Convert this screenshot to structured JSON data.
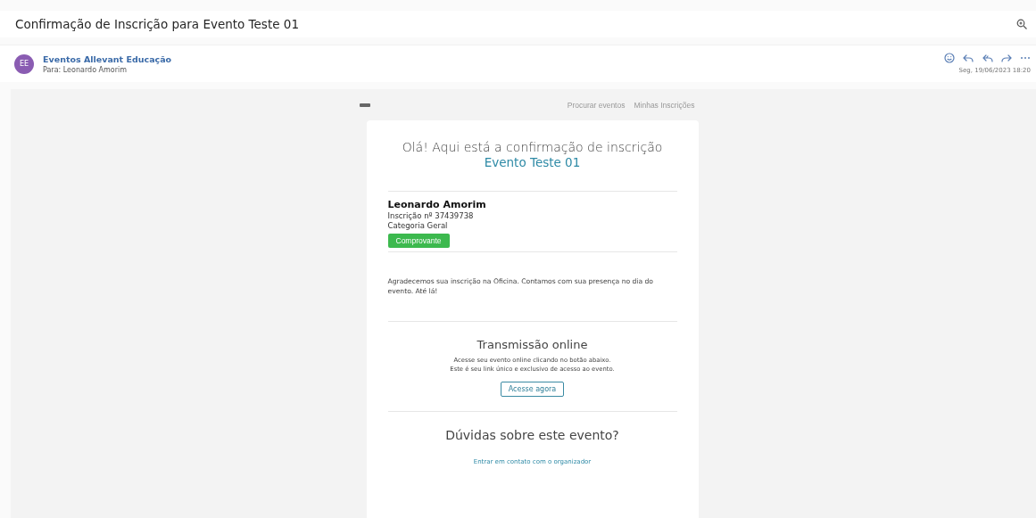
{
  "subject": "Confirmação de Inscrição para Evento Teste 01",
  "sender": {
    "initials": "EE",
    "name": "Eventos Allevant Educação",
    "to": "Para: Leonardo Amorim",
    "date": "Seg, 19/06/2023 18:20"
  },
  "email": {
    "nav": [
      "Procurar eventos",
      "Minhas Inscrições"
    ],
    "greeting": "Olá! Aqui está a confirmação de inscrição",
    "event": "Evento Teste 01",
    "attendee": {
      "name": "Leonardo Amorim",
      "registration": "Inscrição nº 37439738",
      "category": "Categoria Geral",
      "button": "Comprovante"
    },
    "message": "Agradecemos sua inscrição na Oficina. Contamos com sua presença no dia do evento. Até lá!",
    "stream": {
      "title": "Transmissão online",
      "lines": [
        "Acesse seu evento online clicando no botão abaixo.",
        "Este é seu link único e exclusivo de acesso ao evento."
      ],
      "button": "Acesse agora"
    },
    "questions": {
      "title": "Dúvidas sobre este evento?",
      "link": "Entrar em contato com o organizador"
    }
  }
}
